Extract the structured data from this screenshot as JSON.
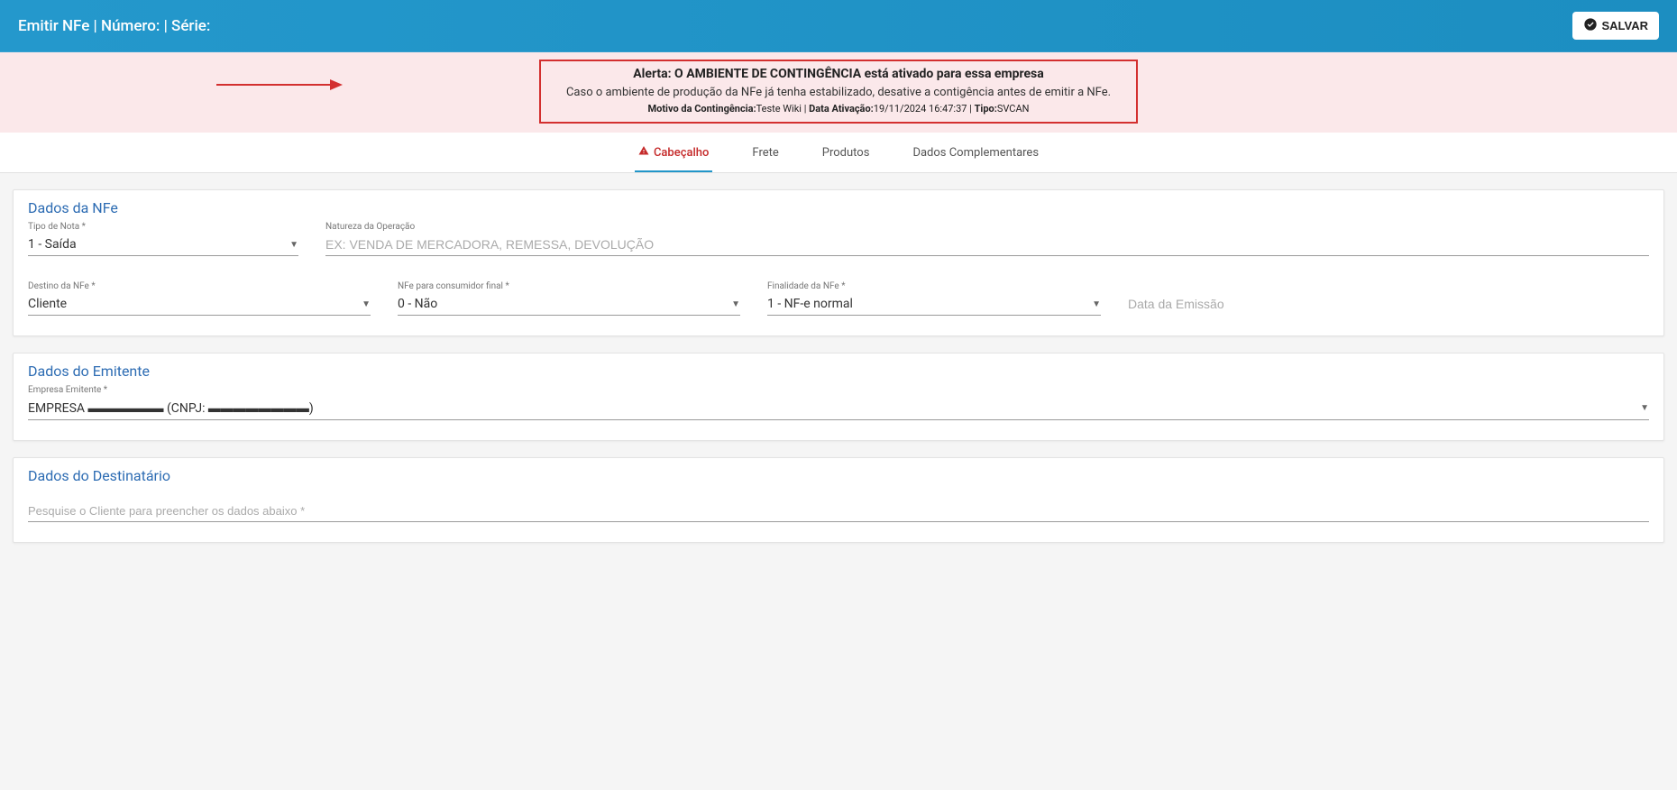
{
  "header": {
    "title": "Emitir NFe | Número: | Série:",
    "save_label": "SALVAR"
  },
  "alert": {
    "title": "Alerta: O AMBIENTE DE CONTINGÊNCIA está ativado para essa empresa",
    "subtitle": "Caso o ambiente de produção da NFe já tenha estabilizado, desative a contigência antes de emitir a NFe.",
    "meta_motivo_label": "Motivo da Contingência:",
    "meta_motivo_value": "Teste Wiki",
    "meta_data_label": "Data Ativação:",
    "meta_data_value": "19/11/2024 16:47:37",
    "meta_tipo_label": "Tipo:",
    "meta_tipo_value": "SVCAN"
  },
  "tabs": [
    {
      "label": "Cabeçalho",
      "active": true
    },
    {
      "label": "Frete"
    },
    {
      "label": "Produtos"
    },
    {
      "label": "Dados Complementares"
    }
  ],
  "section_nfe": {
    "title": "Dados da NFe",
    "tipo_nota": {
      "label": "Tipo de Nota *",
      "value": "1 - Saída"
    },
    "natureza": {
      "label": "Natureza da Operação",
      "placeholder": "EX: VENDA DE MERCADORA, REMESSA, DEVOLUÇÃO"
    },
    "destino": {
      "label": "Destino da NFe *",
      "value": "Cliente"
    },
    "consumidor": {
      "label": "NFe para consumidor final *",
      "value": "0 - Não"
    },
    "finalidade": {
      "label": "Finalidade da NFe *",
      "value": "1 - NF-e normal"
    },
    "data_emissao": {
      "label": "Data da Emissão",
      "placeholder": "Data da Emissão"
    }
  },
  "section_emitente": {
    "title": "Dados do Emitente",
    "empresa": {
      "label": "Empresa Emitente *",
      "value": "EMPRESA ▬▬▬▬▬▬ (CNPJ: ▬▬▬▬▬▬▬▬)"
    }
  },
  "section_destinatario": {
    "title": "Dados do Destinatário",
    "cliente": {
      "label": "Pesquise o Cliente para preencher os dados abaixo *",
      "placeholder": "Pesquise o Cliente para preencher os dados abaixo *"
    }
  }
}
